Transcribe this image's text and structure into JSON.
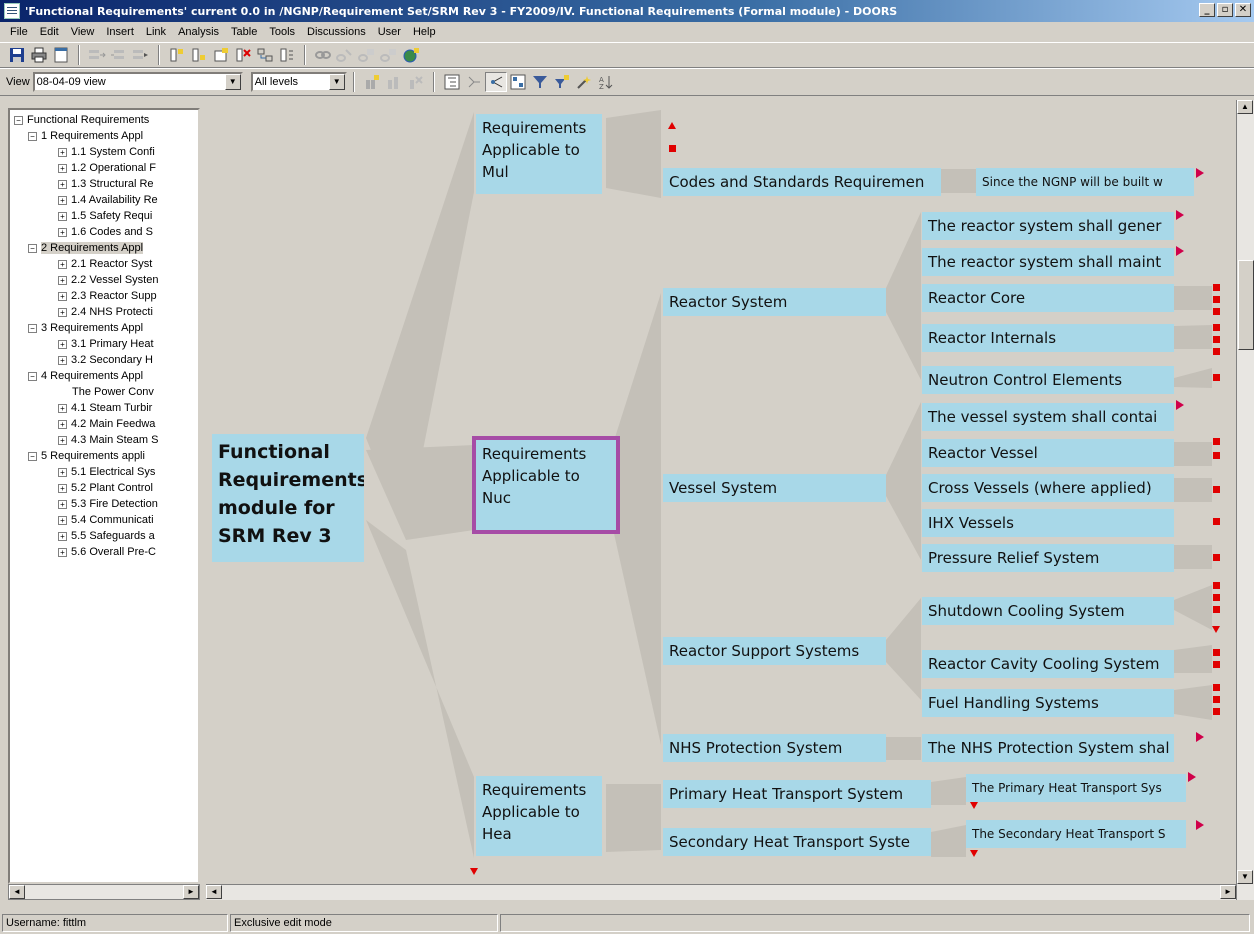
{
  "window": {
    "title": "'Functional Requirements' current 0.0 in /NGNP/Requirement Set/SRM Rev 3 - FY2009/IV. Functional Requirements (Formal module) - DOORS",
    "min_glyph": "_",
    "max_glyph": "▫",
    "close_glyph": "✕"
  },
  "menu": [
    "File",
    "Edit",
    "View",
    "Insert",
    "Link",
    "Analysis",
    "Table",
    "Tools",
    "Discussions",
    "User",
    "Help"
  ],
  "toolbar2": {
    "view_label": "View",
    "view_value": "08-04-09 view",
    "levels_value": "All levels",
    "arrow_glyph": "▼"
  },
  "tree": {
    "expanded_glyph": "−",
    "collapsed_glyph": "+",
    "items": [
      {
        "label": "Functional Requirements"
      },
      {
        "label": "1 Requirements Appl"
      },
      {
        "label": "1.1 System Confi"
      },
      {
        "label": "1.2 Operational F"
      },
      {
        "label": "1.3 Structural Re"
      },
      {
        "label": "1.4 Availability Re"
      },
      {
        "label": "1.5 Safety Requi"
      },
      {
        "label": "1.6 Codes and S"
      },
      {
        "label": "2 Requirements Appl"
      },
      {
        "label": "2.1 Reactor Syst"
      },
      {
        "label": "2.2 Vessel Systen"
      },
      {
        "label": "2.3 Reactor Supp"
      },
      {
        "label": "2.4 NHS Protecti"
      },
      {
        "label": "3 Requirements Appl"
      },
      {
        "label": "3.1 Primary Heat"
      },
      {
        "label": "3.2 Secondary H"
      },
      {
        "label": "4 Requirements Appl"
      },
      {
        "label": "The Power Conv"
      },
      {
        "label": "4.1 Steam Turbir"
      },
      {
        "label": "4.2 Main Feedwa"
      },
      {
        "label": "4.3 Main Steam S"
      },
      {
        "label": "5 Requirements appli"
      },
      {
        "label": "5.1 Electrical Sys"
      },
      {
        "label": "5.2 Plant Control"
      },
      {
        "label": "5.3 Fire Detection"
      },
      {
        "label": "5.4 Communicati"
      },
      {
        "label": "5.5 Safeguards a"
      },
      {
        "label": "5.6 Overall Pre-C"
      }
    ]
  },
  "diagram": {
    "root": "Functional Requirements module for SRM Rev 3",
    "l1": [
      "Requirements Applicable to Mul",
      "Requirements Applicable to Nuc",
      "Requirements Applicable to Hea"
    ],
    "l2": [
      "Codes and Standards Requiremen",
      "Reactor System",
      "Vessel System",
      "Reactor Support Systems",
      "NHS Protection System",
      "Primary Heat Transport System",
      "Secondary Heat Transport Syste"
    ],
    "l3": [
      "Since the NGNP will be built w",
      "The reactor system shall gener",
      "The reactor system shall maint",
      "Reactor Core",
      "Reactor Internals",
      "Neutron Control Elements",
      "The vessel system shall contai",
      "Reactor Vessel",
      "Cross Vessels (where applied)",
      "IHX Vessels",
      "Pressure Relief System",
      "Shutdown Cooling System",
      "Reactor Cavity Cooling System",
      "Fuel Handling Systems",
      "The NHS Protection System shal",
      "The Primary Heat Transport Sys",
      "The Secondary Heat Transport S"
    ]
  },
  "status": {
    "username": "Username: fittlm",
    "mode": "Exclusive edit mode"
  },
  "scroll": {
    "left_glyph": "◄",
    "right_glyph": "►",
    "up_glyph": "▲",
    "down_glyph": "▼"
  }
}
